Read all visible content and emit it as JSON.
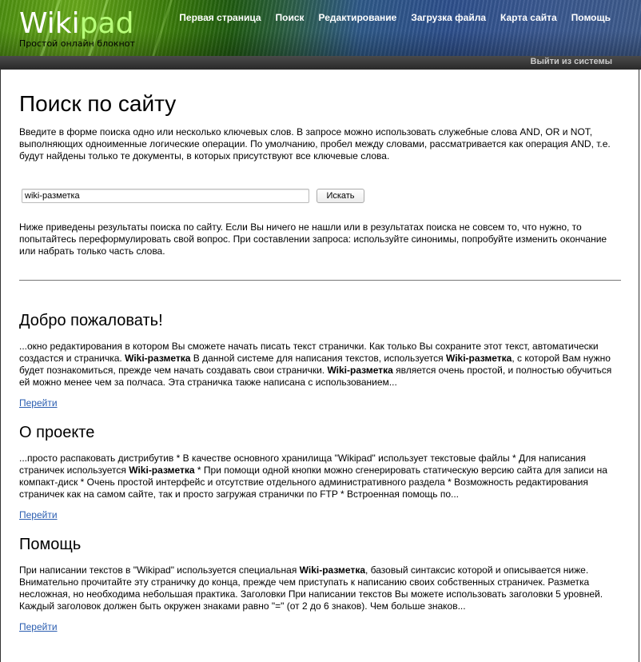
{
  "header": {
    "logo_wiki": "Wiki",
    "logo_pad": "pad",
    "tagline": "Простой онлайн блокнот",
    "nav": [
      {
        "label": "Первая страница"
      },
      {
        "label": "Поиск"
      },
      {
        "label": "Редактирование"
      },
      {
        "label": "Загрузка файла"
      },
      {
        "label": "Карта сайта"
      },
      {
        "label": "Помощь"
      }
    ],
    "logout": "Выйти из системы"
  },
  "main": {
    "title": "Поиск по сайту",
    "intro": "Введите в форме поиска одно или несколько ключевых слов. В запросе можно использовать служебные слова AND, OR и NOT, выполняющих одноименные логические операции. По умолчанию, пробел между словами, рассматривается как операция AND, т.е. будут найдены только те документы, в которых присутствуют все ключевые слова.",
    "search": {
      "value": "wiki-разметка",
      "button_label": "Искать"
    },
    "results_intro": "Ниже приведены результаты поиска по сайту. Если Вы ничего не нашли или в результатах поиска не совсем то, что нужно, то попытайтесь переформулировать свой вопрос. При составлении запроса: используйте синонимы, попробуйте изменить окончание или набрать только часть слова."
  },
  "results": [
    {
      "title": "Добро пожаловать!",
      "parts": [
        {
          "t": "...окно редактирования в котором Вы сможете начать писать текст странички. Как только Вы сохраните этот текст, автоматически создастся и страничка. "
        },
        {
          "b": "Wiki-разметка"
        },
        {
          "t": " В данной системе для написания текстов, используется "
        },
        {
          "b": "Wiki-разметка"
        },
        {
          "t": ", с которой Вам нужно будет познакомиться, прежде чем начать создавать свои странички. "
        },
        {
          "b": "Wiki-разметка"
        },
        {
          "t": " является очень простой, и полностью обучиться ей можно менее чем за полчаса. Эта страничка также написана с использованием..."
        }
      ],
      "link": "Перейти"
    },
    {
      "title": "О проекте",
      "parts": [
        {
          "t": "...просто распаковать дистрибутив * В качестве основного хранилища \"Wikipad\" использует текстовые файлы * Для написания страничек используется "
        },
        {
          "b": "Wiki-разметка"
        },
        {
          "t": " * При помощи одной кнопки можно сгенерировать статическую версию сайта для записи на компакт-диск * Очень простой интерфейс и отсутствие отдельного административного раздела * Возможность редактирования страничек как на самом сайте, так и просто загружая странички по FTP * Встроенная помощь по..."
        }
      ],
      "link": "Перейти"
    },
    {
      "title": "Помощь",
      "parts": [
        {
          "t": "При написании текстов в \"Wikipad\" используется специальная "
        },
        {
          "b": "Wiki-разметка"
        },
        {
          "t": ", базовый синтаксис которой и описывается ниже. Внимательно прочитайте эту страничку до конца, прежде чем приступать к написанию своих собственных страничек. Разметка несложная, но необходима небольшая практика. Заголовки При написании текстов Вы можете использовать заголовки 5 уровней. Каждый заголовок должен быть окружен знаками равно \"=\" (от 2 до 6 знаков). Чем больше знаков..."
        }
      ],
      "link": "Перейти"
    }
  ]
}
